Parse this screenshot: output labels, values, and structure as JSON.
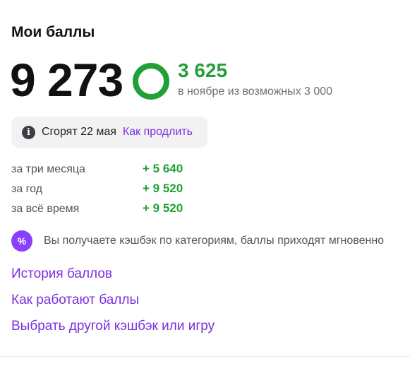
{
  "title": "Мои баллы",
  "balance": "9 273",
  "earned": {
    "value": "3 625",
    "caption": "в ноябре из возможных 3 000"
  },
  "expiry": {
    "icon": "info-icon",
    "icon_glyph": "i",
    "text": "Сгорят 22 мая",
    "link": "Как продлить"
  },
  "stats": [
    {
      "label": "за три месяца",
      "value": "+ 5 640"
    },
    {
      "label": "за год",
      "value": "+ 9 520"
    },
    {
      "label": "за всё время",
      "value": "+ 9 520"
    }
  ],
  "cashback": {
    "icon": "percent-icon",
    "icon_glyph": "%",
    "text": "Вы получаете кэшбэк по категориям, баллы приходят мгновенно"
  },
  "links": [
    "История баллов",
    "Как работают баллы",
    "Выбрать другой кэшбэк или игру"
  ],
  "colors": {
    "accent_green": "#21a038",
    "link_purple": "#7b2fe0",
    "badge_purple": "#8a3ffc"
  }
}
